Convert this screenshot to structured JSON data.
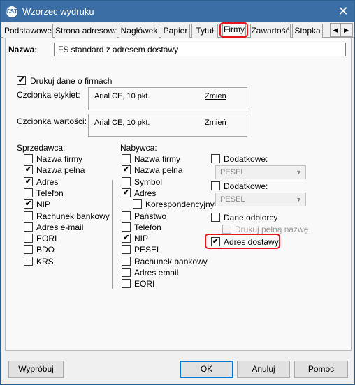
{
  "window": {
    "title": "Wzorzec wydruku",
    "app_icon_text": "CST"
  },
  "tabs": [
    {
      "label": "Podstawowe"
    },
    {
      "label": "Strona adresowa"
    },
    {
      "label": "Nagłówek"
    },
    {
      "label": "Papier"
    },
    {
      "label": "Tytuł"
    },
    {
      "label": "Firmy",
      "active": true,
      "highlighted": true
    },
    {
      "label": "Zawartość"
    },
    {
      "label": "Stopka"
    }
  ],
  "name_field": {
    "label": "Nazwa:",
    "value": "FS standard z adresem dostawy"
  },
  "print_companies": {
    "label": "Drukuj dane o firmach",
    "checked": true
  },
  "label_font": {
    "label": "Czcionka etykiet:",
    "value": "Arial CE, 10 pkt.",
    "link": "Zmień"
  },
  "value_font": {
    "label": "Czcionka wartości:",
    "value": "Arial CE, 10 pkt.",
    "link": "Zmień"
  },
  "seller": {
    "title": "Sprzedawca:",
    "items": [
      {
        "label": "Nazwa firmy",
        "checked": false
      },
      {
        "label": "Nazwa pełna",
        "checked": true
      },
      {
        "label": "Adres",
        "checked": true
      },
      {
        "label": "Telefon",
        "checked": false
      },
      {
        "label": "NIP",
        "checked": true
      },
      {
        "label": "Rachunek bankowy",
        "checked": false
      },
      {
        "label": "Adres e-mail",
        "checked": false
      },
      {
        "label": "EORI",
        "checked": false
      },
      {
        "label": "BDO",
        "checked": false
      },
      {
        "label": "KRS",
        "checked": false
      }
    ]
  },
  "buyer": {
    "title": "Nabywca:",
    "items": [
      {
        "label": "Nazwa firmy",
        "checked": false
      },
      {
        "label": "Nazwa pełna",
        "checked": true
      },
      {
        "label": "Symbol",
        "checked": false
      },
      {
        "label": "Adres",
        "checked": true
      },
      {
        "label": "Korespondencyjny",
        "checked": false
      },
      {
        "label": "Państwo",
        "checked": false
      },
      {
        "label": "Telefon",
        "checked": false
      },
      {
        "label": "NIP",
        "checked": true
      },
      {
        "label": "PESEL",
        "checked": false
      },
      {
        "label": "Rachunek bankowy",
        "checked": false
      },
      {
        "label": "Adres email",
        "checked": false
      },
      {
        "label": "EORI",
        "checked": false
      }
    ]
  },
  "additional": {
    "dodatkowe1": {
      "label": "Dodatkowe:",
      "checked": false,
      "select": "PESEL"
    },
    "dodatkowe2": {
      "label": "Dodatkowe:",
      "checked": false,
      "select": "PESEL"
    },
    "recipient": {
      "label": "Dane odbiorcy",
      "checked": false
    },
    "print_full_name": {
      "label": "Drukuj pełną nazwę",
      "checked": false,
      "disabled": true
    },
    "delivery_address": {
      "label": "Adres dostawy",
      "checked": true,
      "highlighted": true
    }
  },
  "buttons": {
    "preview": "Wypróbuj",
    "ok": "OK",
    "cancel": "Anuluj",
    "help": "Pomoc"
  },
  "glyphs": {
    "check": "✔",
    "close": "✕",
    "left": "◀",
    "right": "▶",
    "dropdown": "▼"
  },
  "colors": {
    "titlebar": "#3a6ea5",
    "highlight": "#e8141f"
  }
}
